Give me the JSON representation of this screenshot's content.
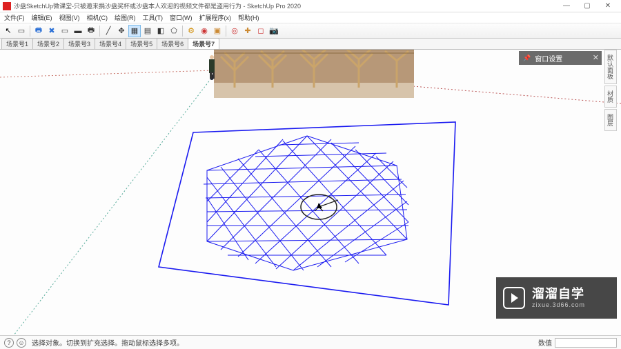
{
  "title": "沙盘SketchUp微课堂-只被邀来捐沙盘奖杯或沙盘本人欢迎的视频文件都是盗用行为 - SketchUp Pro 2020",
  "window": {
    "min": "—",
    "max": "▢",
    "close": "✕"
  },
  "menu": [
    "文件(F)",
    "编辑(E)",
    "视图(V)",
    "相机(C)",
    "绘图(R)",
    "工具(T)",
    "窗口(W)",
    "扩展程序(x)",
    "帮助(H)"
  ],
  "toolbar_icons": {
    "arrow": "↖",
    "box": "▭",
    "poly": "⬠",
    "print": "🖶",
    "del": "✖",
    "rect": "▭",
    "brush": "▬",
    "ruler": "╱",
    "grid": "▦",
    "pan": "✥",
    "page": "▤",
    "tag": "◧",
    "gear": "⚙",
    "red1": "◉",
    "box2": "▣",
    "cyl": "◎",
    "plug": "✚",
    "cube": "◻",
    "cam": "📷"
  },
  "scenes": [
    "场景号1",
    "场景号2",
    "场景号3",
    "场景号4",
    "场景号5",
    "场景号6",
    "场景号7"
  ],
  "active_scene": 6,
  "panel": {
    "title": "窗口设置",
    "pin": "📌",
    "close": "✕"
  },
  "tray": [
    "默认面板",
    "材质",
    "图层"
  ],
  "status": {
    "help": "?",
    "user": "☺",
    "hint": "选择对象。切换到扩充选择。拖动鼠标选择多项。",
    "vcb_label": "数值"
  },
  "watermark": {
    "big": "溜溜自学",
    "small": "zixue.3d66.com"
  },
  "colors": {
    "edge": "#1a1af0",
    "horizon": "#d9c0b8",
    "axis_r": "#cc2222",
    "axis_g": "#117733"
  }
}
